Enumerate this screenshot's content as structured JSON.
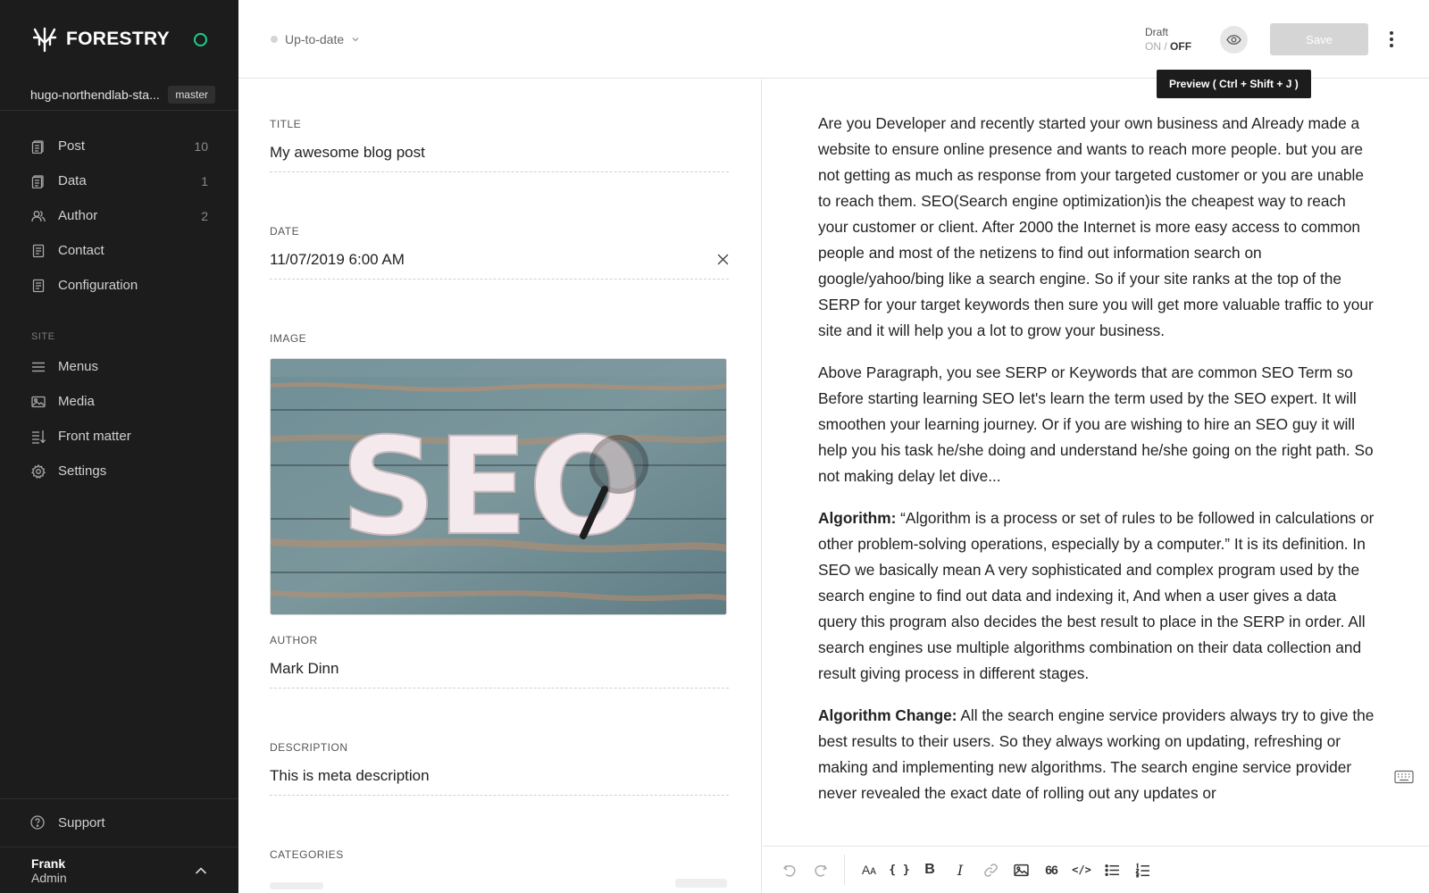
{
  "app": {
    "logo_text": "FORESTRY",
    "repo_name": "hugo-northendlab-sta...",
    "branch": "master"
  },
  "sidebar": {
    "items": [
      {
        "label": "Post",
        "count": "10",
        "icon": "document-icon"
      },
      {
        "label": "Data",
        "count": "1",
        "icon": "document-icon"
      },
      {
        "label": "Author",
        "count": "2",
        "icon": "users-icon"
      },
      {
        "label": "Contact",
        "count": "",
        "icon": "page-icon"
      },
      {
        "label": "Configuration",
        "count": "",
        "icon": "page-icon"
      }
    ],
    "site_section_label": "SITE",
    "site_items": [
      {
        "label": "Menus",
        "icon": "menu-icon"
      },
      {
        "label": "Media",
        "icon": "image-icon"
      },
      {
        "label": "Front matter",
        "icon": "sort-icon"
      },
      {
        "label": "Settings",
        "icon": "gear-icon"
      }
    ],
    "support_label": "Support",
    "user": {
      "name": "Frank",
      "role": "Admin"
    }
  },
  "topbar": {
    "status": "Up-to-date",
    "draft_label": "Draft",
    "draft_on": "ON",
    "draft_sep": "/",
    "draft_off": "OFF",
    "save_label": "Save",
    "tooltip": "Preview ( Ctrl + Shift + J )"
  },
  "fields": {
    "title_label": "TITLE",
    "title_value": "My awesome blog post",
    "date_label": "DATE",
    "date_value": "11/07/2019 6:00 AM",
    "image_label": "IMAGE",
    "image_text": "SEO",
    "author_label": "AUTHOR",
    "author_value": "Mark Dinn",
    "description_label": "DESCRIPTION",
    "description_value": "This is meta description",
    "categories_label": "CATEGORIES"
  },
  "editor": {
    "p1": "Are you Developer and recently started your own business and Already made a website to ensure online presence and wants to reach more people. but you are not getting as much as response from your targeted customer or you are unable to reach them. SEO(Search engine optimization)is the cheapest way to reach your customer or client. After 2000 the Internet is more easy access to common people and most of the netizens to find out information search on google/yahoo/bing like a search engine. So if your site ranks at the top of the SERP for your target keywords then sure you will get more valuable traffic to your site and it will help you a lot to grow your business.",
    "p2": "Above Paragraph, you see SERP or Keywords that are common SEO Term so Before starting learning SEO let's learn the term used by the SEO expert. It will smoothen your learning journey. Or if you are wishing to hire an SEO guy it will help you his task he/she doing and understand he/she going on the right path. So not making delay let dive...",
    "p3_bold": "Algorithm:",
    "p3": " “Algorithm is a process or set of rules to be followed in calculations or other problem-solving operations, especially by a computer.” It is its definition. In SEO we basically mean A very sophisticated and complex program used by the search engine to find out data and indexing it, And when a user gives a data query this program also decides the best result to place in the SERP in order. All search engines use multiple algorithms combination on their data collection and result giving process in different stages.",
    "p4_bold": "Algorithm Change:",
    "p4": " All the search engine service providers always try to give the best results to their users. So they always working on updating, refreshing or making and implementing new algorithms. The search engine service provider never revealed the exact date of rolling out any updates or"
  },
  "toolbar": {
    "heading_glyph": "Aᴀ",
    "code_glyph": "{ }",
    "bold_glyph": "B",
    "italic_glyph": "I",
    "quote_glyph": "66",
    "html_glyph": "</>"
  },
  "colors": {
    "sidebar_bg": "#1c1c1c",
    "status_green": "#1fce8b",
    "save_disabled": "#d5d5d5"
  }
}
